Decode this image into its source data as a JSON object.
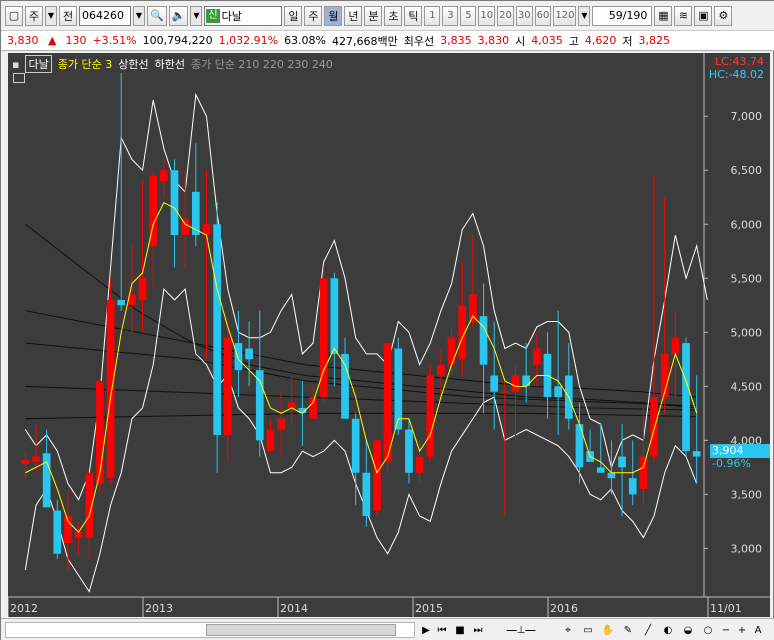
{
  "toolbar": {
    "market_label": "주",
    "prev_label": "전",
    "code": "064260",
    "new_badge": "신",
    "name": "다날",
    "periods": [
      "일",
      "주",
      "월",
      "년"
    ],
    "active_period": "월",
    "sub_periods": [
      "분",
      "초",
      "틱"
    ],
    "numbers": [
      "1",
      "3",
      "5",
      "10",
      "20",
      "30",
      "60",
      "120"
    ],
    "count": "59/190"
  },
  "quote": {
    "price": "3,830",
    "arrow": "▲",
    "change": "130",
    "change_pct": "+3.51%",
    "volume": "100,794,220",
    "volume_pct": "1,032.91%",
    "turnover": "63.08%",
    "amount": "427,668백만",
    "best_bid_label": "최우선",
    "best_ask": "3,835",
    "best_bid": "3,830",
    "open_label": "시",
    "open": "4,035",
    "high_label": "고",
    "high": "4,620",
    "low_label": "저",
    "low": "3,825"
  },
  "legend": {
    "stock": "다날",
    "ma_label": "종가 단순 3",
    "upper": "상한선",
    "lower": "하한선",
    "ma_multi": "종가 단순 210  220  230  240"
  },
  "lc": "LC:43.74",
  "hc": "HC:-48.02",
  "last_price_tag": "3,904",
  "last_pct_tag": "-0.96%",
  "colors": {
    "up": "#ff0000",
    "down": "#29c7f0",
    "ma": "#ffff00",
    "band": "#ffffff",
    "bg": "#3c3c3c"
  },
  "chart_data": {
    "type": "candlestick",
    "y_axis_ticks": [
      3000,
      3500,
      4000,
      4500,
      5000,
      5500,
      6000,
      6500,
      7000
    ],
    "ylim": [
      2550,
      7400
    ],
    "x_tick_labels": [
      "2012",
      "2013",
      "2014",
      "2015",
      "2016",
      "11/01"
    ],
    "ohlc": [
      [
        3780,
        3900,
        3650,
        3820
      ],
      [
        3800,
        4150,
        3700,
        3850
      ],
      [
        3880,
        4100,
        3400,
        3380
      ],
      [
        3350,
        3450,
        2900,
        2950
      ],
      [
        3050,
        3550,
        2800,
        3300
      ],
      [
        3100,
        3250,
        2950,
        3150
      ],
      [
        3100,
        3700,
        2900,
        3700
      ],
      [
        3600,
        4550,
        3500,
        4550
      ],
      [
        3650,
        5500,
        3600,
        5300
      ],
      [
        5300,
        7400,
        5200,
        5250
      ],
      [
        5250,
        5800,
        5000,
        5350
      ],
      [
        5300,
        6400,
        5000,
        5500
      ],
      [
        5800,
        6500,
        5400,
        6450
      ],
      [
        6400,
        6600,
        6250,
        6500
      ],
      [
        6500,
        6600,
        5600,
        5900
      ],
      [
        5900,
        6500,
        5600,
        6050
      ],
      [
        6300,
        6750,
        5800,
        5900
      ],
      [
        5900,
        6500,
        4750,
        6000
      ],
      [
        6000,
        6200,
        3700,
        4050
      ],
      [
        4050,
        5100,
        3800,
        4950
      ],
      [
        4900,
        5200,
        4400,
        4650
      ],
      [
        4850,
        5100,
        4500,
        4750
      ],
      [
        4650,
        5200,
        3850,
        4000
      ],
      [
        3900,
        4200,
        3900,
        4100
      ],
      [
        4100,
        4450,
        3850,
        4200
      ],
      [
        4300,
        4600,
        4150,
        4350
      ],
      [
        4300,
        4550,
        3950,
        4250
      ],
      [
        4200,
        4500,
        4200,
        4400
      ],
      [
        4400,
        5600,
        4350,
        5500
      ],
      [
        5500,
        5550,
        4500,
        4800
      ],
      [
        4800,
        4950,
        4200,
        4200
      ],
      [
        4200,
        4250,
        3400,
        3700
      ],
      [
        3700,
        4000,
        3200,
        3300
      ],
      [
        3350,
        4000,
        3300,
        4000
      ],
      [
        3800,
        4900,
        3700,
        4900
      ],
      [
        4850,
        4950,
        4050,
        4100
      ],
      [
        4100,
        4200,
        3600,
        3700
      ],
      [
        3700,
        4000,
        3600,
        3850
      ],
      [
        3850,
        4700,
        3800,
        4600
      ],
      [
        4600,
        4850,
        4400,
        4700
      ],
      [
        4700,
        5050,
        4600,
        4950
      ],
      [
        4750,
        5650,
        4600,
        5250
      ],
      [
        5100,
        5900,
        5050,
        5350
      ],
      [
        5150,
        5450,
        4250,
        4700
      ],
      [
        4600,
        5100,
        4100,
        4450
      ],
      [
        4450,
        4550,
        3300,
        4450
      ],
      [
        4450,
        4700,
        4000,
        4600
      ],
      [
        4600,
        4900,
        4350,
        4500
      ],
      [
        4700,
        5000,
        4500,
        4850
      ],
      [
        4800,
        5000,
        4200,
        4400
      ],
      [
        4500,
        5200,
        4050,
        4400
      ],
      [
        4600,
        4900,
        4100,
        4200
      ],
      [
        4150,
        4350,
        3600,
        3750
      ],
      [
        3900,
        4100,
        3850,
        3800
      ],
      [
        3750,
        4150,
        3700,
        3700
      ],
      [
        3700,
        4000,
        3500,
        3650
      ],
      [
        3850,
        4150,
        3300,
        3750
      ],
      [
        3650,
        4000,
        3400,
        3500
      ],
      [
        3550,
        4300,
        3400,
        3850
      ],
      [
        3850,
        6450,
        3800,
        4400
      ],
      [
        4400,
        6250,
        4250,
        4800
      ],
      [
        4800,
        5200,
        4400,
        4950
      ],
      [
        4900,
        4950,
        3850,
        3900
      ],
      [
        3900,
        4600,
        3600,
        3850
      ]
    ],
    "ma3": [
      3700,
      3750,
      3800,
      3550,
      3250,
      3150,
      3300,
      3700,
      4400,
      5000,
      5450,
      5550,
      6000,
      6200,
      6150,
      6000,
      5950,
      5900,
      5400,
      5050,
      4750,
      4650,
      4550,
      4300,
      4250,
      4300,
      4250,
      4350,
      4650,
      4850,
      4700,
      4400,
      4000,
      3700,
      3850,
      4200,
      4200,
      3900,
      4050,
      4400,
      4700,
      4950,
      5150,
      5050,
      4850,
      4550,
      4500,
      4500,
      4600,
      4600,
      4550,
      4400,
      4150,
      3850,
      3800,
      3700,
      3700,
      3700,
      3750,
      4100,
      4450,
      4800,
      4550,
      4250
    ],
    "upper_band": [
      4100,
      3950,
      4050,
      3900,
      3600,
      3450,
      3700,
      4400,
      5600,
      6800,
      6600,
      6500,
      7150,
      6700,
      6400,
      6300,
      7200,
      7000,
      6100,
      5400,
      5000,
      4950,
      4950,
      5000,
      5200,
      5350,
      4800,
      4900,
      5650,
      5850,
      5500,
      4950,
      4800,
      4800,
      4700,
      5100,
      5000,
      4700,
      4900,
      5200,
      5450,
      5950,
      6100,
      5800,
      5200,
      4850,
      4900,
      4850,
      5050,
      5100,
      5100,
      5000,
      4500,
      4200,
      4150,
      3750,
      4000,
      4050,
      4000,
      4750,
      5300,
      5900,
      5500,
      5800,
      5300
    ],
    "lower_band": [
      2800,
      3400,
      3550,
      3250,
      2900,
      2750,
      2600,
      2950,
      3400,
      3700,
      4200,
      4300,
      4700,
      5400,
      5300,
      5400,
      4800,
      4700,
      4500,
      4600,
      4300,
      4200,
      4050,
      3700,
      3700,
      3750,
      3900,
      3850,
      3900,
      4000,
      3900,
      3600,
      3350,
      3100,
      2950,
      3150,
      3500,
      3300,
      3250,
      3600,
      3900,
      4050,
      4200,
      4350,
      4400,
      4000,
      4050,
      4100,
      4050,
      4000,
      3950,
      3850,
      3700,
      3500,
      3450,
      3550,
      3350,
      3250,
      3100,
      3300,
      3700,
      3950,
      3850,
      3600
    ]
  }
}
